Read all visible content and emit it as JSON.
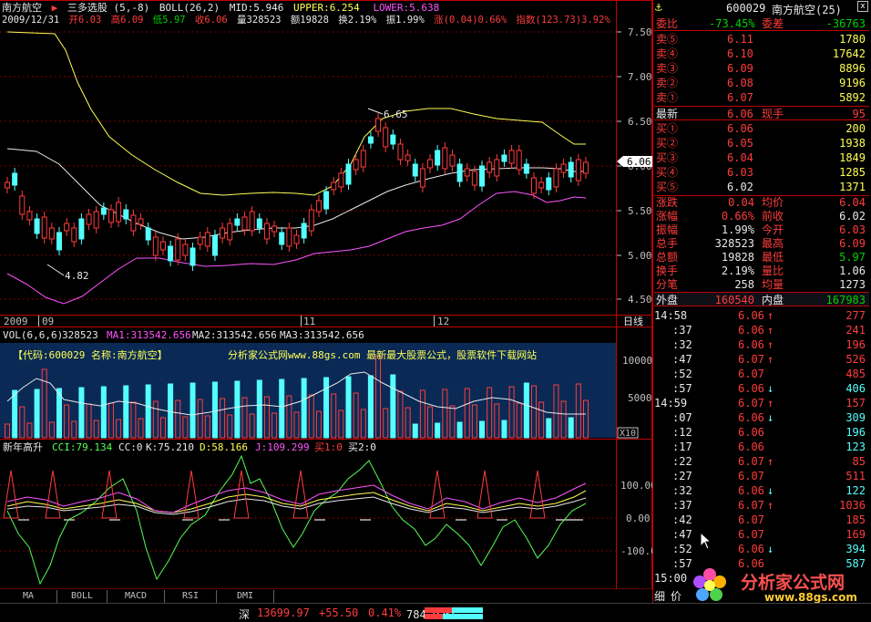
{
  "header": {
    "stock_name": "南方航空",
    "formula": "三多选股 (5,-8)",
    "boll_params": "BOLL(26,2)",
    "mid": "MID:5.946",
    "upper": "UPPER:6.254",
    "lower": "LOWER:5.638",
    "date": "2009/12/31",
    "open": "开6.03",
    "high": "高6.09",
    "low": "低5.97",
    "close": "收6.06",
    "volume": "量328523",
    "amount": "额19828",
    "turnover": "换2.19%",
    "amplitude": "振1.99%",
    "change": "涨(0.04)0.66%",
    "index": "指数(123.73)3.92%"
  },
  "price_axis": [
    "7.50",
    "7.00",
    "6.50",
    "6.00",
    "5.50",
    "5.00",
    "4.50"
  ],
  "price_tag": "6.06",
  "annotations": {
    "high": "6.65",
    "low": "4.82"
  },
  "time_axis": {
    "labels": [
      "2009",
      "09",
      "11",
      "12"
    ],
    "period": "日线"
  },
  "volume": {
    "title": "VOL(6,6,6)",
    "value": "328523",
    "ma1": "MA1:313542.656",
    "ma2": "MA2:313542.656",
    "ma3": "MA3:313542.656",
    "info": "【代码:600029 名称:南方航空】",
    "watermark": "分析家公式网www.88gs.com 最新最大股票公式，股票软件下载网站",
    "axis": [
      "100000",
      "50000"
    ],
    "unit": "X10"
  },
  "indicator": {
    "title": "新年高升",
    "cci": "CCI:79.134",
    "cc": "CC:0",
    "k": "K:75.210",
    "d": "D:58.166",
    "j": "J:109.299",
    "buy1": "买1:0",
    "buy2": "买2:0",
    "axis": [
      "100.00",
      "0.00",
      "-100.0"
    ]
  },
  "tabs": [
    "MA",
    "BOLL",
    "MACD",
    "RSI",
    "DMI"
  ],
  "right_panel": {
    "code": "600029",
    "name": "南方航空(25)",
    "weibi_label": "委比",
    "weibi": "-73.45%",
    "weicha_label": "委差",
    "weicha": "-36763",
    "asks": [
      {
        "label": "卖⑤",
        "price": "6.11",
        "vol": "1780"
      },
      {
        "label": "卖④",
        "price": "6.10",
        "vol": "17642"
      },
      {
        "label": "卖③",
        "price": "6.09",
        "vol": "8896"
      },
      {
        "label": "卖②",
        "price": "6.08",
        "vol": "9196"
      },
      {
        "label": "卖①",
        "price": "6.07",
        "vol": "5892"
      }
    ],
    "latest_label": "最新",
    "latest": "6.06",
    "xianshou_label": "现手",
    "xianshou": "95",
    "bids": [
      {
        "label": "买①",
        "price": "6.06",
        "vol": "200"
      },
      {
        "label": "买②",
        "price": "6.05",
        "vol": "1938"
      },
      {
        "label": "买③",
        "price": "6.04",
        "vol": "1849"
      },
      {
        "label": "买④",
        "price": "6.03",
        "vol": "1285"
      },
      {
        "label": "买⑤",
        "price": "6.02",
        "vol": "1371"
      }
    ],
    "stats": [
      {
        "l1": "涨跌",
        "v1": "0.04",
        "l2": "均价",
        "v2": "6.04",
        "c1": "red",
        "c2": "red"
      },
      {
        "l1": "涨幅",
        "v1": "0.66%",
        "l2": "前收",
        "v2": "6.02",
        "c1": "red",
        "c2": "white"
      },
      {
        "l1": "振幅",
        "v1": "1.99%",
        "l2": "今开",
        "v2": "6.03",
        "c1": "white",
        "c2": "red"
      },
      {
        "l1": "总手",
        "v1": "328523",
        "l2": "最高",
        "v2": "6.09",
        "c1": "white",
        "c2": "red"
      },
      {
        "l1": "总额",
        "v1": "19828",
        "l2": "最低",
        "v2": "5.97",
        "c1": "white",
        "c2": "green"
      },
      {
        "l1": "换手",
        "v1": "2.19%",
        "l2": "量比",
        "v2": "1.06",
        "c1": "white",
        "c2": "white"
      },
      {
        "l1": "分笔",
        "v1": "258",
        "l2": "均量",
        "v2": "1273",
        "c1": "white",
        "c2": "white"
      }
    ],
    "outer_label": "外盘",
    "outer": "160540",
    "inner_label": "内盘",
    "inner": "167983",
    "ticks": [
      {
        "t": "14:58",
        "p": "6.06",
        "v": "277",
        "a": "↑",
        "pc": "red",
        "vc": "red"
      },
      {
        "t": ":37",
        "p": "6.06",
        "v": "241",
        "a": "↑",
        "pc": "red",
        "vc": "red"
      },
      {
        "t": ":32",
        "p": "6.06",
        "v": "196",
        "a": "↑",
        "pc": "red",
        "vc": "red"
      },
      {
        "t": ":47",
        "p": "6.07",
        "v": "526",
        "a": "↑",
        "pc": "red",
        "vc": "red"
      },
      {
        "t": ":52",
        "p": "6.07",
        "v": "485",
        "a": "",
        "pc": "red",
        "vc": "red"
      },
      {
        "t": ":57",
        "p": "6.06",
        "v": "406",
        "a": "↓",
        "pc": "red",
        "vc": "cyan"
      },
      {
        "t": "14:59",
        "p": "6.07",
        "v": "157",
        "a": "↑",
        "pc": "red",
        "vc": "red"
      },
      {
        "t": ":07",
        "p": "6.06",
        "v": "309",
        "a": "↓",
        "pc": "red",
        "vc": "cyan"
      },
      {
        "t": ":12",
        "p": "6.06",
        "v": "196",
        "a": "",
        "pc": "red",
        "vc": "cyan"
      },
      {
        "t": ":17",
        "p": "6.06",
        "v": "123",
        "a": "",
        "pc": "red",
        "vc": "cyan"
      },
      {
        "t": ":22",
        "p": "6.07",
        "v": "85",
        "a": "↑",
        "pc": "red",
        "vc": "red"
      },
      {
        "t": ":27",
        "p": "6.07",
        "v": "511",
        "a": "",
        "pc": "red",
        "vc": "red"
      },
      {
        "t": ":32",
        "p": "6.06",
        "v": "122",
        "a": "↓",
        "pc": "red",
        "vc": "cyan"
      },
      {
        "t": ":37",
        "p": "6.07",
        "v": "1036",
        "a": "↑",
        "pc": "red",
        "vc": "red"
      },
      {
        "t": ":42",
        "p": "6.07",
        "v": "185",
        "a": "",
        "pc": "red",
        "vc": "red"
      },
      {
        "t": ":47",
        "p": "6.07",
        "v": "169",
        "a": "",
        "pc": "red",
        "vc": "red"
      },
      {
        "t": ":52",
        "p": "6.06",
        "v": "394",
        "a": "↓",
        "pc": "red",
        "vc": "cyan"
      },
      {
        "t": ":57",
        "p": "6.06",
        "v": "587",
        "a": "",
        "pc": "red",
        "vc": "cyan"
      },
      {
        "t": "15:00",
        "p": "",
        "v": "",
        "a": "",
        "pc": "red",
        "vc": "red"
      }
    ],
    "detail_label": "细",
    "price_label": "价"
  },
  "status": {
    "market": "深",
    "index": "13699.97",
    "change": "+55.50",
    "pct": "0.41%",
    "amount": "784.92亿"
  },
  "logo": {
    "text": "分析家公式网",
    "url": "www.88gs.com"
  }
}
